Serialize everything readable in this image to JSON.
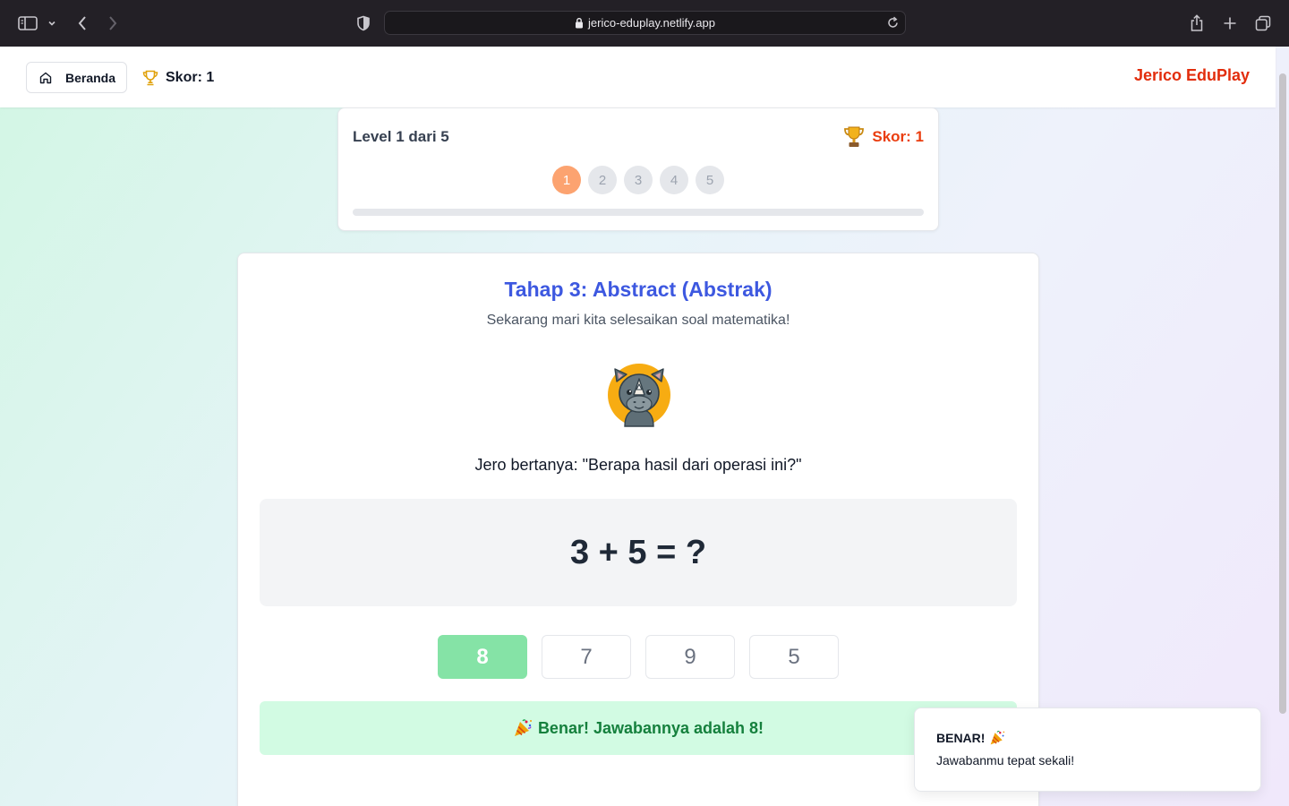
{
  "browser": {
    "url": "jerico-eduplay.netlify.app"
  },
  "nav": {
    "home_label": "Beranda",
    "score": "Skor: 1",
    "brand": "Jerico EduPlay"
  },
  "level": {
    "title": "Level 1 dari 5",
    "score": "Skor: 1",
    "steps": [
      "1",
      "2",
      "3",
      "4",
      "5"
    ],
    "current_step": 1,
    "progress": 0
  },
  "stage": {
    "title": "Tahap 3: Abstract (Abstrak)",
    "subtitle": "Sekarang mari kita selesaikan soal matematika!",
    "question": "Jero bertanya: \"Berapa hasil dari operasi ini?\"",
    "equation": "3 + 5 = ?",
    "options": [
      "8",
      "7",
      "9",
      "5"
    ],
    "correct_option": "8",
    "result": "Benar! Jawabannya adalah 8!"
  },
  "toast": {
    "title": "BENAR!",
    "message": "Jawabanmu tepat sekali!"
  },
  "colors": {
    "brand": "#e22d0c",
    "stage_title": "#3d58e0",
    "active_step": "#fca370",
    "correct_option": "#85e3a6",
    "result_bg": "#d2fbe3",
    "result_text": "#15803d"
  },
  "icons": {
    "sidebar": "sidebar-icon",
    "back": "back-icon",
    "forward": "forward-icon",
    "shield": "shield-icon",
    "lock": "lock-icon",
    "reload": "reload-icon",
    "share": "share-icon",
    "new_tab": "plus-icon",
    "tabs": "tabs-icon",
    "home": "home-icon",
    "trophy": "trophy-icon",
    "mascot": "rhino-mascot",
    "party": "party-popper-icon"
  }
}
